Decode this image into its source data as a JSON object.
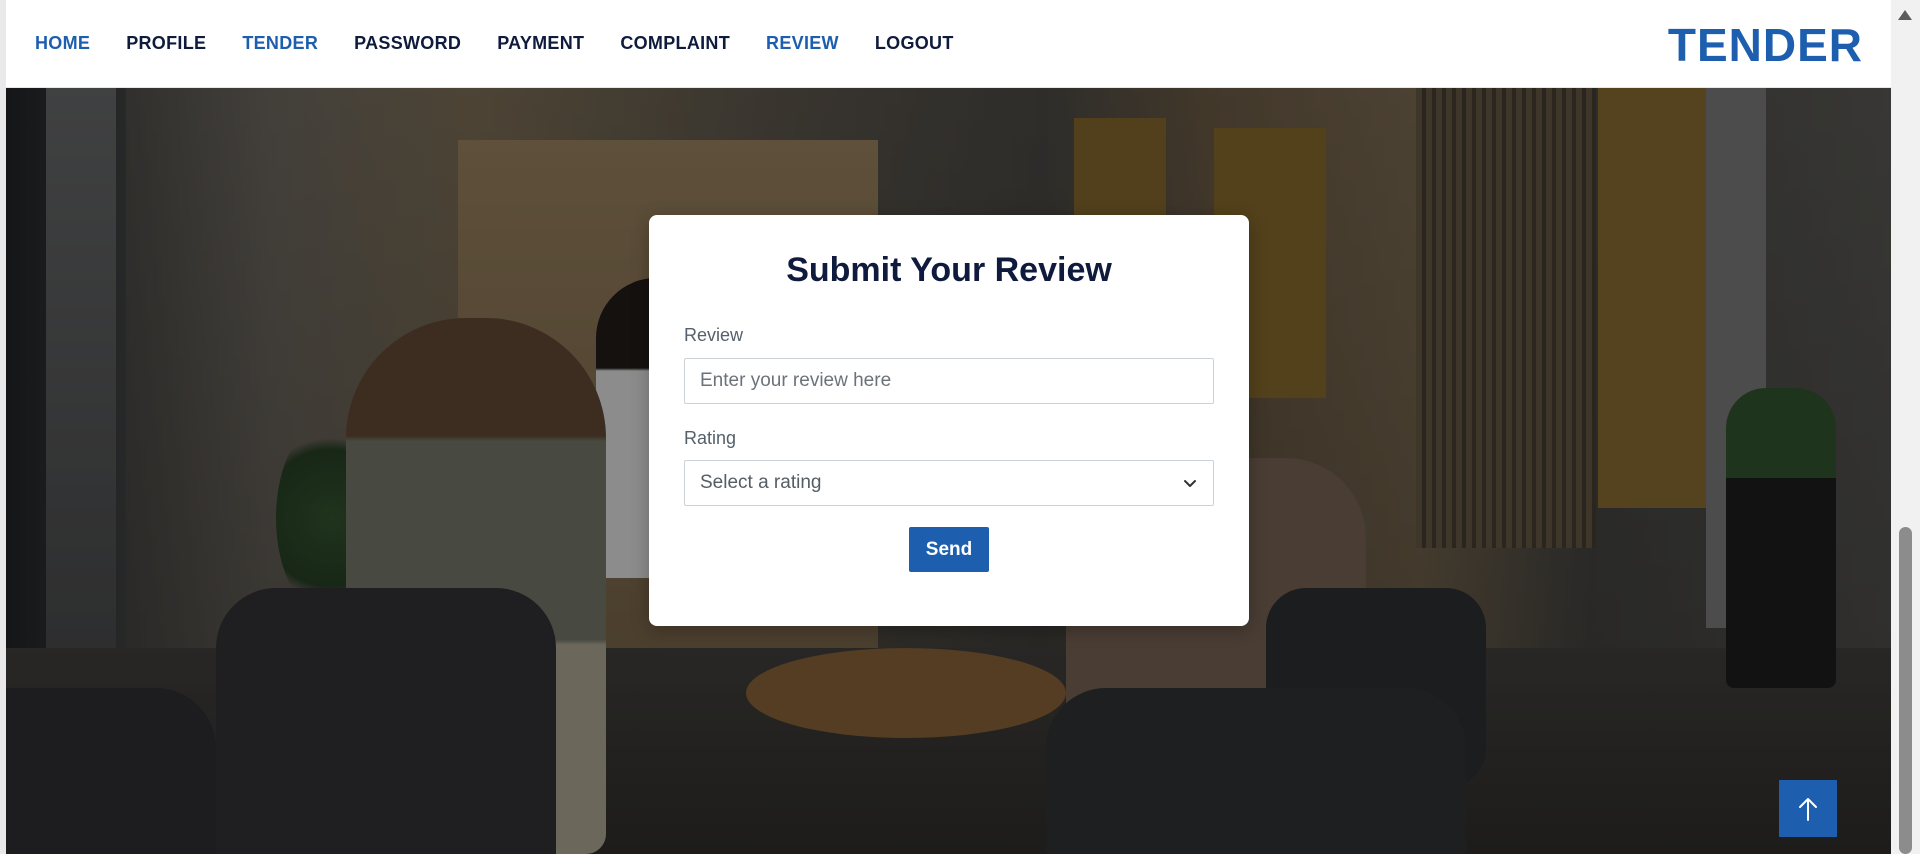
{
  "nav": {
    "items": [
      {
        "label": "HOME",
        "active": true
      },
      {
        "label": "PROFILE",
        "active": false
      },
      {
        "label": "TENDER",
        "active": true
      },
      {
        "label": "PASSWORD",
        "active": false
      },
      {
        "label": "PAYMENT",
        "active": false
      },
      {
        "label": "COMPLAINT",
        "active": false
      },
      {
        "label": "REVIEW",
        "active": true
      },
      {
        "label": "LOGOUT",
        "active": false
      }
    ],
    "brand": "TENDER"
  },
  "form": {
    "title": "Submit Your Review",
    "review_label": "Review",
    "review_placeholder": "Enter your review here",
    "review_value": "",
    "rating_label": "Rating",
    "rating_selected": "Select a rating",
    "submit_label": "Send"
  },
  "icons": {
    "rating_dropdown": "chevron-down-icon",
    "back_to_top": "arrow-up-icon"
  },
  "colors": {
    "accent": "#1d5fae",
    "nav_text": "#0f1b3d",
    "title_text": "#0f1b3d"
  }
}
